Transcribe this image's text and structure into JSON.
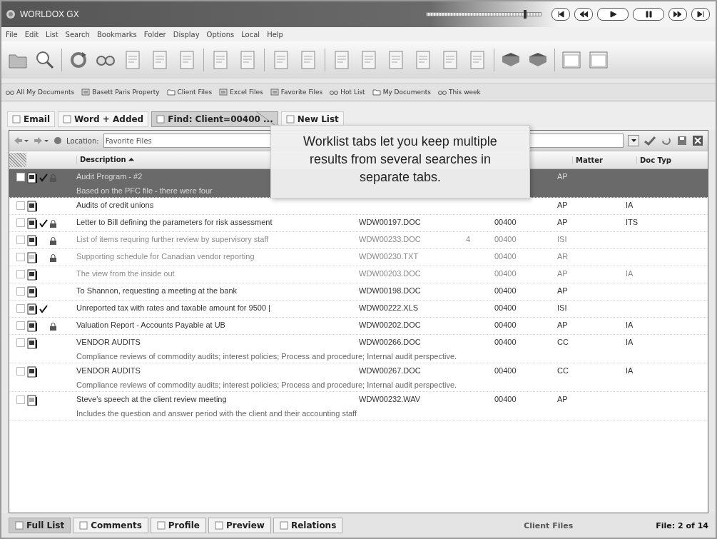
{
  "window": {
    "title": "WORLDOX GX"
  },
  "player": {
    "level": 0.86
  },
  "menu": [
    "File",
    "Edit",
    "List",
    "Search",
    "Bookmarks",
    "Folder",
    "Display",
    "Options",
    "Local",
    "Help"
  ],
  "bookmarks": [
    {
      "label": "All My Documents",
      "kind": "search"
    },
    {
      "label": "Basett Paris Property",
      "kind": "list"
    },
    {
      "label": "Client Files",
      "kind": "folder"
    },
    {
      "label": "Excel Files",
      "kind": "list"
    },
    {
      "label": "Favorite Files",
      "kind": "list"
    },
    {
      "label": "Hot List",
      "kind": "search"
    },
    {
      "label": "My Documents",
      "kind": "folder"
    },
    {
      "label": "This week",
      "kind": "search"
    }
  ],
  "worklist_tabs": [
    {
      "label": "Email",
      "selected": false
    },
    {
      "label": "Word + Added",
      "selected": false
    },
    {
      "label": "Find: Client=00400 ...",
      "selected": true
    },
    {
      "label": "New List",
      "selected": false
    }
  ],
  "location": {
    "label": "Location:",
    "value": "Favorite Files"
  },
  "columns": [
    {
      "label": "Description ⏶"
    },
    {
      "label": "Matter"
    },
    {
      "label": "Doc Typ"
    }
  ],
  "rows": [
    {
      "checked": false,
      "kind": "doc",
      "marked": true,
      "locked": true,
      "selected": true,
      "dimmed": false,
      "description": "Audit Program - #2",
      "comment": "Based on the PFC file - there were four",
      "file": "",
      "version": "",
      "client": "",
      "matter": "AP",
      "doctype": ""
    },
    {
      "checked": false,
      "kind": "doc",
      "marked": false,
      "locked": false,
      "selected": false,
      "dimmed": false,
      "description": "Audits of credit unions",
      "file": "",
      "version": "",
      "client": "",
      "matter": "AP",
      "doctype": "IA"
    },
    {
      "checked": false,
      "kind": "doc",
      "marked": true,
      "locked": true,
      "selected": false,
      "dimmed": false,
      "description": "Letter to Bill defining the parameters for risk assessment",
      "file": "WDW00197.DOC",
      "version": "",
      "client": "00400",
      "matter": "AP",
      "doctype": "ITS"
    },
    {
      "checked": false,
      "kind": "doc",
      "marked": false,
      "locked": true,
      "selected": false,
      "dimmed": true,
      "description": "List of items requring further review by supervisory staff",
      "file": "WDW00233.DOC",
      "version": "4",
      "client": "00400",
      "matter": "ISI",
      "doctype": ""
    },
    {
      "checked": false,
      "kind": "txt",
      "marked": false,
      "locked": true,
      "selected": false,
      "dimmed": true,
      "description": "Supporting schedule for Canadian vendor reporting",
      "file": "WDW00230.TXT",
      "version": "",
      "client": "00400",
      "matter": "AR",
      "doctype": ""
    },
    {
      "checked": false,
      "kind": "doc",
      "marked": false,
      "locked": false,
      "selected": false,
      "dimmed": true,
      "description": "The view from the inside out",
      "file": "WDW00203.DOC",
      "version": "",
      "client": "00400",
      "matter": "AP",
      "doctype": "IA"
    },
    {
      "checked": false,
      "kind": "doc",
      "marked": false,
      "locked": false,
      "selected": false,
      "dimmed": false,
      "description": "To Shannon, requesting a meeting at the bank",
      "file": "WDW00198.DOC",
      "version": "",
      "client": "00400",
      "matter": "AP",
      "doctype": ""
    },
    {
      "checked": false,
      "kind": "xls",
      "marked": true,
      "locked": false,
      "selected": false,
      "dimmed": false,
      "description": "Unreported tax with rates and taxable amount for 9500 |",
      "file": "WDW00222.XLS",
      "version": "",
      "client": "00400",
      "matter": "ISI",
      "doctype": ""
    },
    {
      "checked": false,
      "kind": "doc",
      "marked": false,
      "locked": true,
      "selected": false,
      "dimmed": false,
      "description": "Valuation Report - Accounts Payable at UB",
      "file": "WDW00202.DOC",
      "version": "",
      "client": "00400",
      "matter": "AP",
      "doctype": "IA"
    },
    {
      "checked": false,
      "kind": "doc",
      "marked": false,
      "locked": false,
      "selected": false,
      "dimmed": false,
      "description": "VENDOR AUDITS",
      "comment": "Compliance reviews of commodity audits; interest policies; Process and procedure; Internal audit perspective.",
      "file": "WDW00266.DOC",
      "version": "",
      "client": "00400",
      "matter": "CC",
      "doctype": "IA"
    },
    {
      "checked": false,
      "kind": "doc",
      "marked": false,
      "locked": false,
      "selected": false,
      "dimmed": false,
      "description": "VENDOR AUDITS",
      "comment": "Compliance reviews of commodity audits; interest policies; Process and procedure; Internal audit perspective.",
      "file": "WDW00267.DOC",
      "version": "",
      "client": "00400",
      "matter": "CC",
      "doctype": "IA"
    },
    {
      "checked": false,
      "kind": "wav",
      "marked": false,
      "locked": false,
      "selected": false,
      "dimmed": false,
      "description": "Steve's speech at the client review meeting",
      "comment": "Includes the question and answer period with the client and their accounting staff",
      "file": "WDW00232.WAV",
      "version": "",
      "client": "00400",
      "matter": "AP",
      "doctype": ""
    }
  ],
  "tooltip": "Worklist tabs let you keep multiple results from several searches in separate tabs.",
  "bottom_tabs": [
    {
      "label": "Full List",
      "selected": true
    },
    {
      "label": "Comments",
      "selected": false
    },
    {
      "label": "Profile",
      "selected": false
    },
    {
      "label": "Preview",
      "selected": false
    },
    {
      "label": "Relations",
      "selected": false
    }
  ],
  "status": {
    "location": "Client Files",
    "position": "File: 2 of 14"
  }
}
